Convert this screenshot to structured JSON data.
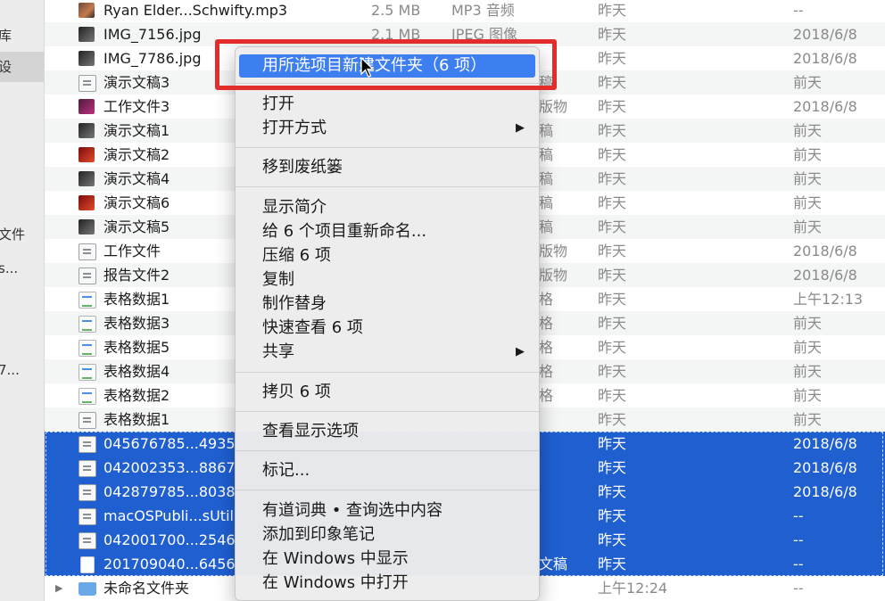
{
  "sidebar": {
    "items": [
      "库",
      "设",
      "文件",
      "s...",
      "7..."
    ]
  },
  "files": [
    {
      "icon": "img",
      "name": "Ryan Elder...Schwifty.mp3",
      "size": "2.5 MB",
      "kind": "MP3 音频",
      "kind_tail": "",
      "date": "昨天",
      "created": "--",
      "selected": false
    },
    {
      "icon": "dark",
      "name": "IMG_7156.jpg",
      "size": "2.1 MB",
      "kind": "JPEG 图像",
      "kind_tail": "",
      "date": "昨天",
      "created": "2018/6/8",
      "selected": false
    },
    {
      "icon": "dark",
      "name": "IMG_7786.jpg",
      "size": "",
      "kind": "",
      "kind_tail": "",
      "date": "昨天",
      "created": "2018/6/8",
      "selected": false
    },
    {
      "icon": "doc",
      "name": "演示文稿3",
      "size": "",
      "kind": "",
      "kind_tail": "稿",
      "date": "昨天",
      "created": "前天",
      "selected": false
    },
    {
      "icon": "pink",
      "name": "工作文件3",
      "size": "",
      "kind": "",
      "kind_tail": "版物",
      "date": "昨天",
      "created": "2018/6/8",
      "selected": false
    },
    {
      "icon": "dark",
      "name": "演示文稿1",
      "size": "",
      "kind": "",
      "kind_tail": "稿",
      "date": "昨天",
      "created": "前天",
      "selected": false
    },
    {
      "icon": "red",
      "name": "演示文稿2",
      "size": "",
      "kind": "",
      "kind_tail": "稿",
      "date": "昨天",
      "created": "前天",
      "selected": false
    },
    {
      "icon": "dark",
      "name": "演示文稿4",
      "size": "",
      "kind": "",
      "kind_tail": "稿",
      "date": "昨天",
      "created": "前天",
      "selected": false
    },
    {
      "icon": "red",
      "name": "演示文稿6",
      "size": "",
      "kind": "",
      "kind_tail": "稿",
      "date": "昨天",
      "created": "前天",
      "selected": false
    },
    {
      "icon": "dark",
      "name": "演示文稿5",
      "size": "",
      "kind": "",
      "kind_tail": "稿",
      "date": "昨天",
      "created": "前天",
      "selected": false
    },
    {
      "icon": "doc",
      "name": "工作文件",
      "size": "",
      "kind": "",
      "kind_tail": "版物",
      "date": "昨天",
      "created": "2018/6/8",
      "selected": false
    },
    {
      "icon": "doc",
      "name": "报告文件2",
      "size": "",
      "kind": "",
      "kind_tail": "版物",
      "date": "昨天",
      "created": "2018/6/8",
      "selected": false
    },
    {
      "icon": "sheet",
      "name": "表格数据1",
      "size": "",
      "kind": "",
      "kind_tail": "格",
      "date": "昨天",
      "created": "上午12:13",
      "selected": false
    },
    {
      "icon": "sheet",
      "name": "表格数据3",
      "size": "",
      "kind": "",
      "kind_tail": "格",
      "date": "昨天",
      "created": "前天",
      "selected": false
    },
    {
      "icon": "sheet",
      "name": "表格数据5",
      "size": "",
      "kind": "",
      "kind_tail": "格",
      "date": "昨天",
      "created": "前天",
      "selected": false
    },
    {
      "icon": "sheet",
      "name": "表格数据4",
      "size": "",
      "kind": "",
      "kind_tail": "格",
      "date": "昨天",
      "created": "前天",
      "selected": false
    },
    {
      "icon": "sheet",
      "name": "表格数据2",
      "size": "",
      "kind": "",
      "kind_tail": "格",
      "date": "昨天",
      "created": "前天",
      "selected": false
    },
    {
      "icon": "doc",
      "name": "表格数据1",
      "size": "",
      "kind": "",
      "kind_tail": "",
      "date": "昨天",
      "created": "前天",
      "selected": false
    },
    {
      "icon": "doc",
      "name": "045676785...4935",
      "size": "",
      "kind": "",
      "kind_tail": "",
      "date": "昨天",
      "created": "2018/6/8",
      "selected": true
    },
    {
      "icon": "doc",
      "name": "042002353...8867",
      "size": "",
      "kind": "",
      "kind_tail": "",
      "date": "昨天",
      "created": "2018/6/8",
      "selected": true
    },
    {
      "icon": "doc",
      "name": "042879785...8038",
      "size": "",
      "kind": "",
      "kind_tail": "",
      "date": "昨天",
      "created": "2018/6/8",
      "selected": true
    },
    {
      "icon": "doc",
      "name": "macOSPubli...sUtil",
      "size": "",
      "kind": "",
      "kind_tail": "",
      "date": "昨天",
      "created": "--",
      "selected": true
    },
    {
      "icon": "doc",
      "name": "042001700...2546",
      "size": "",
      "kind": "",
      "kind_tail": "",
      "date": "昨天",
      "created": "--",
      "selected": true
    },
    {
      "icon": "page",
      "name": "201709040...6456",
      "size": "",
      "kind": "",
      "kind_tail": "文稿",
      "date": "昨天",
      "created": "--",
      "selected": true
    },
    {
      "icon": "folder",
      "name": "未命名文件夹",
      "size": "",
      "kind": "",
      "kind_tail": "",
      "date": "上午12:24",
      "created": "--",
      "selected": false,
      "disclosure": "▶"
    }
  ],
  "context_menu": {
    "new_folder_label": "用所选项目新建文件夹（6 项）",
    "open_label": "打开",
    "open_with_label": "打开方式",
    "move_to_trash_label": "移到废纸篓",
    "get_info_label": "显示简介",
    "rename_label": "给 6 个项目重新命名...",
    "compress_label": "压缩 6 项",
    "duplicate_label": "复制",
    "make_alias_label": "制作替身",
    "quick_look_label": "快速查看 6 项",
    "share_label": "共享",
    "copy_label": "拷贝 6 项",
    "view_options_label": "查看显示选项",
    "tags_label": "标记...",
    "youdao_label": "有道词典 • 查询选中内容",
    "evernote_label": "添加到印象笔记",
    "show_in_windows_label": "在 Windows 中显示",
    "open_in_windows_label": "在 Windows 中打开",
    "submenu_arrow": "▶"
  },
  "colors": {
    "selection": "#1f5fd0",
    "menu_highlight": "#3d7ef0",
    "annotation_red": "#e32d2d"
  }
}
